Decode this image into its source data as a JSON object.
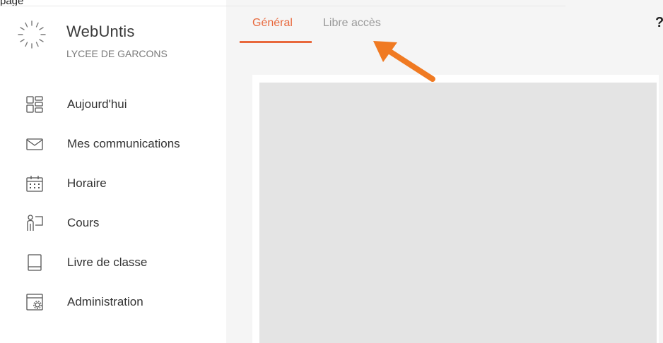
{
  "top_fragment": "page",
  "brand": {
    "name": "WebUntis",
    "school": "LYCEE DE GARCONS",
    "logo_icon": "sunburst-logo-icon"
  },
  "nav": {
    "items": [
      {
        "label": "Aujourd'hui",
        "icon": "dashboard-grid-icon"
      },
      {
        "label": "Mes communications",
        "icon": "envelope-icon"
      },
      {
        "label": "Horaire",
        "icon": "calendar-icon"
      },
      {
        "label": "Cours",
        "icon": "person-board-icon"
      },
      {
        "label": "Livre de classe",
        "icon": "book-icon"
      },
      {
        "label": "Administration",
        "icon": "admin-settings-icon"
      }
    ]
  },
  "tabs": [
    {
      "label": "Général",
      "active": true
    },
    {
      "label": "Libre accès",
      "active": false
    }
  ],
  "help": {
    "label": "?"
  },
  "colors": {
    "accent": "#e8683c",
    "arrow": "#f07a22",
    "text": "#333333",
    "muted": "#9a9a9a",
    "main_bg": "#f5f5f5",
    "placeholder": "#e4e4e4"
  }
}
